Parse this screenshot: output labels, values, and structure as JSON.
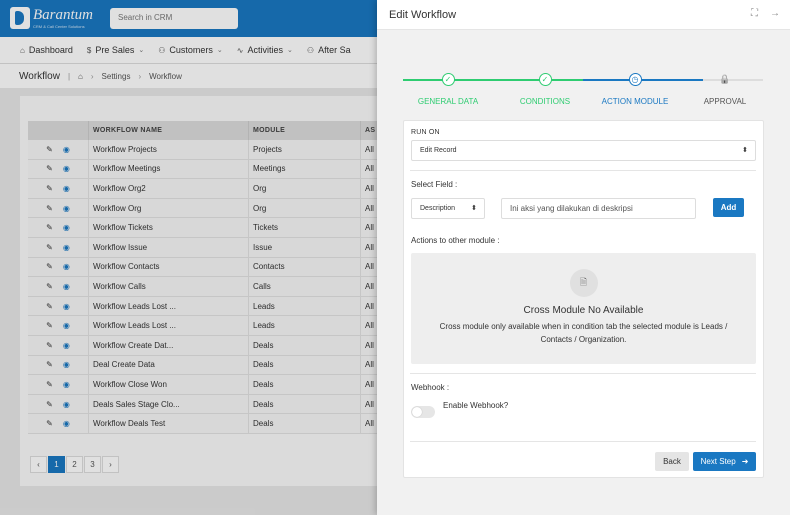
{
  "app": {
    "brand": "Barantum",
    "brand_sub": "CRM & Call Center Solutions",
    "search_placeholder": "Search in CRM"
  },
  "nav": [
    {
      "icon": "⌂",
      "label": "Dashboard"
    },
    {
      "icon": "$",
      "label": "Pre Sales"
    },
    {
      "icon": "⚇",
      "label": "Customers"
    },
    {
      "icon": "∿",
      "label": "Activities"
    },
    {
      "icon": "⚇",
      "label": "After Sa"
    }
  ],
  "breadcrumb": {
    "title": "Workflow",
    "home_icon": "⌂",
    "items": [
      "Settings",
      "Workflow"
    ]
  },
  "table": {
    "headers": {
      "name": "WORKFLOW NAME",
      "module": "MODULE",
      "as": "AS"
    },
    "rows": [
      {
        "name": "Workflow Projects",
        "module": "Projects",
        "as": "All"
      },
      {
        "name": "Workflow Meetings",
        "module": "Meetings",
        "as": "All"
      },
      {
        "name": "Workflow Org2",
        "module": "Org",
        "as": "All"
      },
      {
        "name": "Workflow Org",
        "module": "Org",
        "as": "All"
      },
      {
        "name": "Workflow Tickets",
        "module": "Tickets",
        "as": "All"
      },
      {
        "name": "Workflow Issue",
        "module": "Issue",
        "as": "All"
      },
      {
        "name": "Workflow Contacts",
        "module": "Contacts",
        "as": "All"
      },
      {
        "name": "Workflow Calls",
        "module": "Calls",
        "as": "All"
      },
      {
        "name": "Workflow Leads Lost ...",
        "module": "Leads",
        "as": "All"
      },
      {
        "name": "Workflow Leads Lost ...",
        "module": "Leads",
        "as": "All"
      },
      {
        "name": "Workflow Create Dat...",
        "module": "Deals",
        "as": "All"
      },
      {
        "name": "Deal Create Data",
        "module": "Deals",
        "as": "All"
      },
      {
        "name": "Workflow Close Won",
        "module": "Deals",
        "as": "All"
      },
      {
        "name": "Deals Sales Stage Clo...",
        "module": "Deals",
        "as": "All"
      },
      {
        "name": "Workflow Deals Test",
        "module": "Deals",
        "as": "All"
      }
    ]
  },
  "pager": {
    "prev": "‹",
    "pages": [
      "1",
      "2",
      "3"
    ],
    "next": "›",
    "active": "1"
  },
  "panel": {
    "title": "Edit Workflow",
    "expand_icon": "⛶",
    "close_icon": "→",
    "steps": [
      {
        "label": "GENERAL DATA",
        "state": "done",
        "icon": "✓"
      },
      {
        "label": "CONDITIONS",
        "state": "done",
        "icon": "✓"
      },
      {
        "label": "ACTION MODULE",
        "state": "active",
        "icon": "◷"
      },
      {
        "label": "APPROVAL",
        "state": "locked",
        "icon": "🔒"
      }
    ],
    "colors": {
      "done": "#2ecc71",
      "active": "#1a78c2",
      "pending": "#cccccc"
    },
    "run_on_label": "RUN ON",
    "run_on_value": "Edit Record",
    "select_field_label": "Select Field :",
    "field_select_value": "Description",
    "field_input_value": "Ini aksi yang dilakukan di deskripsi",
    "add_label": "Add",
    "actions_label": "Actions to other module :",
    "empty_icon": "🗎",
    "empty_title": "Cross Module No Available",
    "empty_desc": "Cross module only available when in condition tab the selected module is Leads / Contacts / Organization.",
    "webhook_label": "Webhook :",
    "webhook_toggle_label": "Enable Webhook?",
    "back_label": "Back",
    "next_label": "Next Step",
    "next_icon": "➜"
  }
}
